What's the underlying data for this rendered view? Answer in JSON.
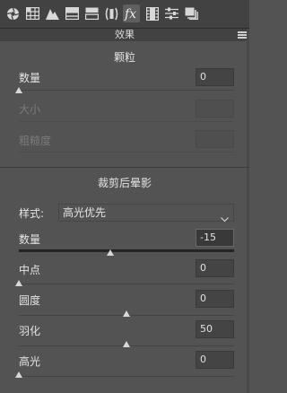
{
  "toolbar": {
    "tools": [
      {
        "icon": "aperture-icon"
      },
      {
        "icon": "grid-icon"
      },
      {
        "icon": "mountain-icon"
      },
      {
        "icon": "split-panel-icon"
      },
      {
        "icon": "detail-panel-icon"
      },
      {
        "icon": "lens-icon"
      },
      {
        "icon": "fx-icon",
        "label": "fx",
        "active": true
      },
      {
        "icon": "film-strip-icon"
      },
      {
        "icon": "sliders-icon"
      },
      {
        "icon": "presets-icon"
      }
    ]
  },
  "panel": {
    "title": "效果"
  },
  "grain": {
    "heading": "颗粒",
    "amount": {
      "label": "数量",
      "value": "0"
    },
    "size": {
      "label": "大小",
      "value": ""
    },
    "roughness": {
      "label": "粗糙度",
      "value": ""
    }
  },
  "vignette": {
    "heading": "裁剪后晕影",
    "style": {
      "label": "样式:",
      "value": "高光优先"
    },
    "amount": {
      "label": "数量",
      "value": "-15"
    },
    "midpoint": {
      "label": "中点",
      "value": "0"
    },
    "roundness": {
      "label": "圆度",
      "value": "0"
    },
    "feather": {
      "label": "羽化",
      "value": "50"
    },
    "highlights": {
      "label": "高光",
      "value": "0"
    }
  },
  "colors": {
    "background": "#535353",
    "toolbar": "#424242",
    "text": "#e6e6e6",
    "disabled_text": "#7b7b7b",
    "thumb": "#d8d8d8"
  }
}
